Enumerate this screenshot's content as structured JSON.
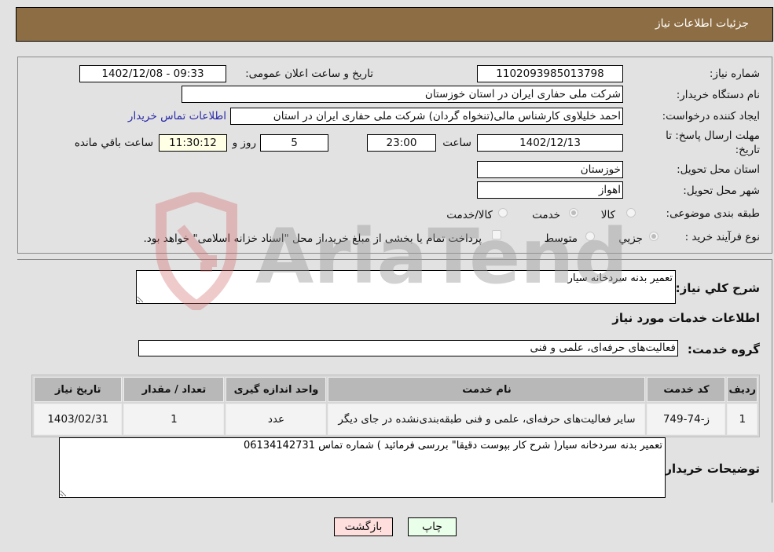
{
  "header": {
    "title": "جزئیات اطلاعات نیاز"
  },
  "form": {
    "need_number": {
      "label": "شماره نیاز:",
      "value": "1102093985013798"
    },
    "announce_datetime": {
      "label": "تاریخ و ساعت اعلان عمومی:",
      "value": "1402/12/08 - 09:33"
    },
    "buyer_org": {
      "label": "نام دستگاه خریدار:",
      "value": "شرکت ملی حفاری ایران در استان خوزستان",
      "extra_value": ""
    },
    "requester": {
      "label": "ایجاد کننده درخواست:",
      "value": "احمد خلیلاوی کارشناس مالی(تنخواه گردان) شرکت ملی حفاری ایران در استان",
      "link": "اطلاعات تماس خریدار"
    },
    "deadline": {
      "label_line1": "مهلت ارسال پاسخ: تا",
      "label_line2": "تاریخ:",
      "date": "1402/12/13",
      "time_label": "ساعت",
      "time": "23:00",
      "days": "5",
      "days_label": "روز و",
      "remaining": "11:30:12",
      "remaining_label": "ساعت باقي مانده"
    },
    "delivery_province": {
      "label": "استان محل تحویل:",
      "value": "خوزستان"
    },
    "delivery_city": {
      "label": "شهر محل تحویل:",
      "value": "اهواز"
    },
    "category": {
      "label": "طبقه بندی موضوعی:",
      "options": [
        "کالا",
        "خدمت",
        "کالا/خدمت"
      ],
      "selected": "خدمت"
    },
    "purchase_type": {
      "label": "نوع فرآیند خرید :",
      "options": [
        "جزيي",
        "متوسط"
      ],
      "selected": "جزيي",
      "treasury_note": "پرداخت تمام یا بخشی از مبلغ خرید،از محل \"اسناد خزانه اسلامی\" خواهد بود."
    }
  },
  "general_description": {
    "label": "شرح کلي نیاز:",
    "value": "تعمیر بدنه سردخانه سیار"
  },
  "services_section": {
    "title": "اطلاعات خدمات مورد نیاز"
  },
  "service_group": {
    "label": "گروه خدمت:",
    "value": "فعالیت‌های حرفه‌ای، علمی و فنی"
  },
  "table": {
    "headers": [
      "ردیف",
      "کد خدمت",
      "نام خدمت",
      "واحد اندازه گیری",
      "تعداد / مقدار",
      "تاریخ نیاز"
    ],
    "rows": [
      [
        "1",
        "ز-74-749",
        "سایر فعالیت‌های حرفه‌ای، علمی و فنی طبقه‌بندی‌نشده در جای دیگر",
        "عدد",
        "1",
        "1403/02/31"
      ]
    ]
  },
  "buyer_notes": {
    "label": "توضیحات خریدار:",
    "value": "تعمیر بدنه سردخانه سیار( شرح کار بپوست دقیقا\" بررسی فرمائید ) شماره تماس 06134142731"
  },
  "buttons": {
    "print": "چاپ",
    "back": "بازگشت"
  },
  "watermark": {
    "text": "AriaTender.neT"
  },
  "colors": {
    "header_bg": "#8d6d43",
    "print_bg": "#eaffea",
    "back_bg": "#ffdede",
    "link": "#2a2aaa"
  }
}
